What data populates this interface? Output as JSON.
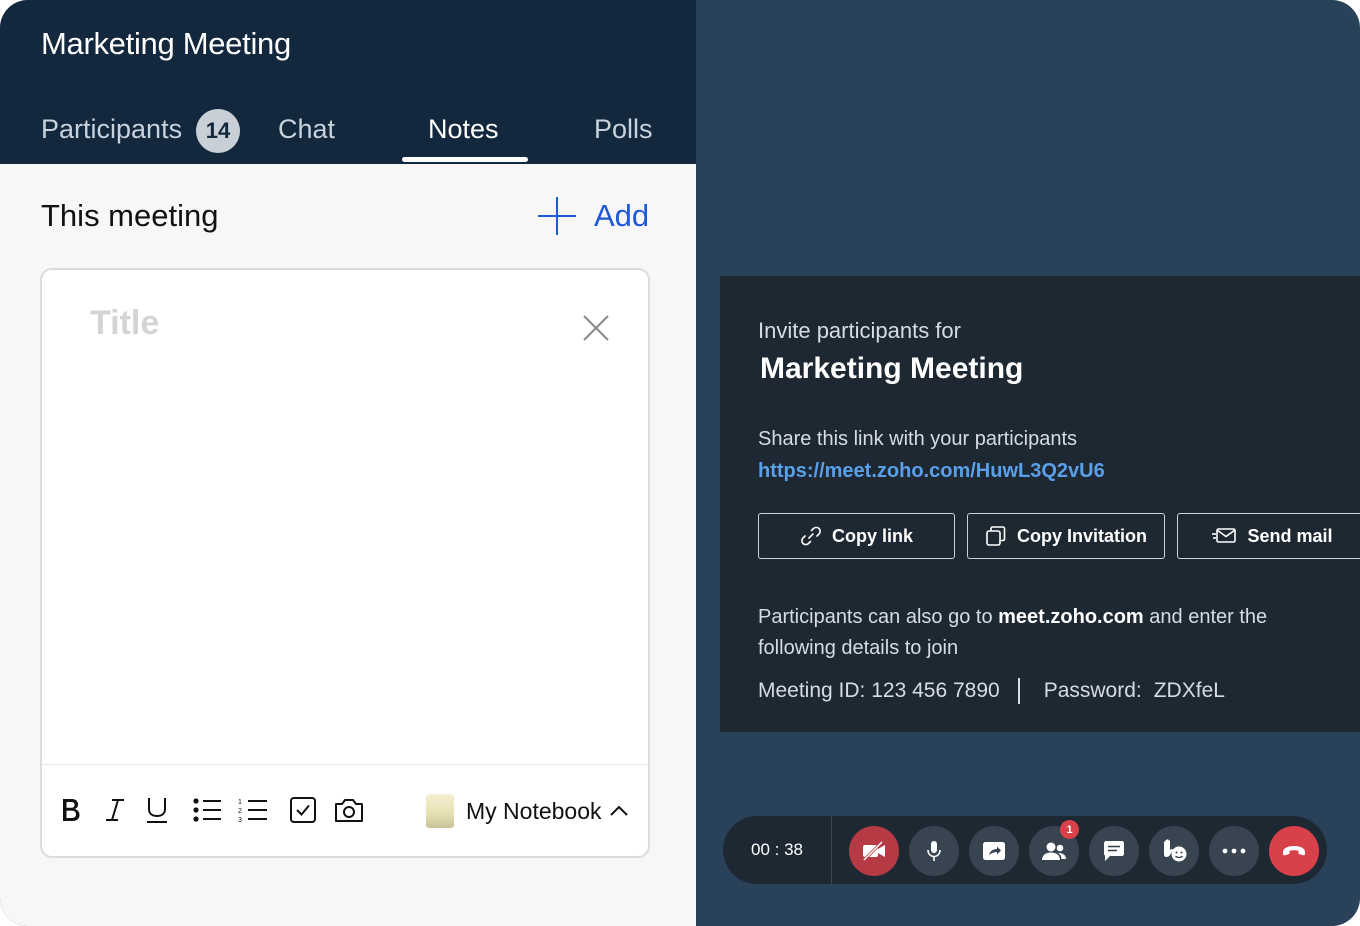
{
  "meeting": {
    "title": "Marketing Meeting"
  },
  "tabs": {
    "participants": "Participants",
    "participants_count": "14",
    "chat": "Chat",
    "notes": "Notes",
    "polls": "Polls",
    "active": "Notes"
  },
  "notes": {
    "section_title": "This meeting",
    "add_label": "Add",
    "title_placeholder": "Title",
    "notebook_label": "My Notebook",
    "toolbar_icons": [
      "bold-icon",
      "italic-icon",
      "underline-icon",
      "bullet-list-icon",
      "numbered-list-icon",
      "checklist-icon",
      "camera-icon"
    ]
  },
  "invite": {
    "subtitle": "Invite participants for",
    "title": "Marketing Meeting",
    "share_text": "Share this link with your participants",
    "link": "https://meet.zoho.com/HuwL3Q2vU6",
    "copy_link": "Copy link",
    "copy_invitation": "Copy Invitation",
    "send_mail": "Send mail",
    "info_prefix": "Participants can also go to ",
    "info_domain": "meet.zoho.com",
    "info_suffix": " and enter the following details to join",
    "meeting_id": "Meeting ID: 123 456 7890",
    "password_label": "Password:",
    "password_value": "ZDXfeL"
  },
  "controls": {
    "timer": "00 : 38",
    "participants_notification": "1",
    "colors": {
      "video_off": "#b63a44",
      "end_call": "#d8404a",
      "button": "#384450"
    }
  }
}
